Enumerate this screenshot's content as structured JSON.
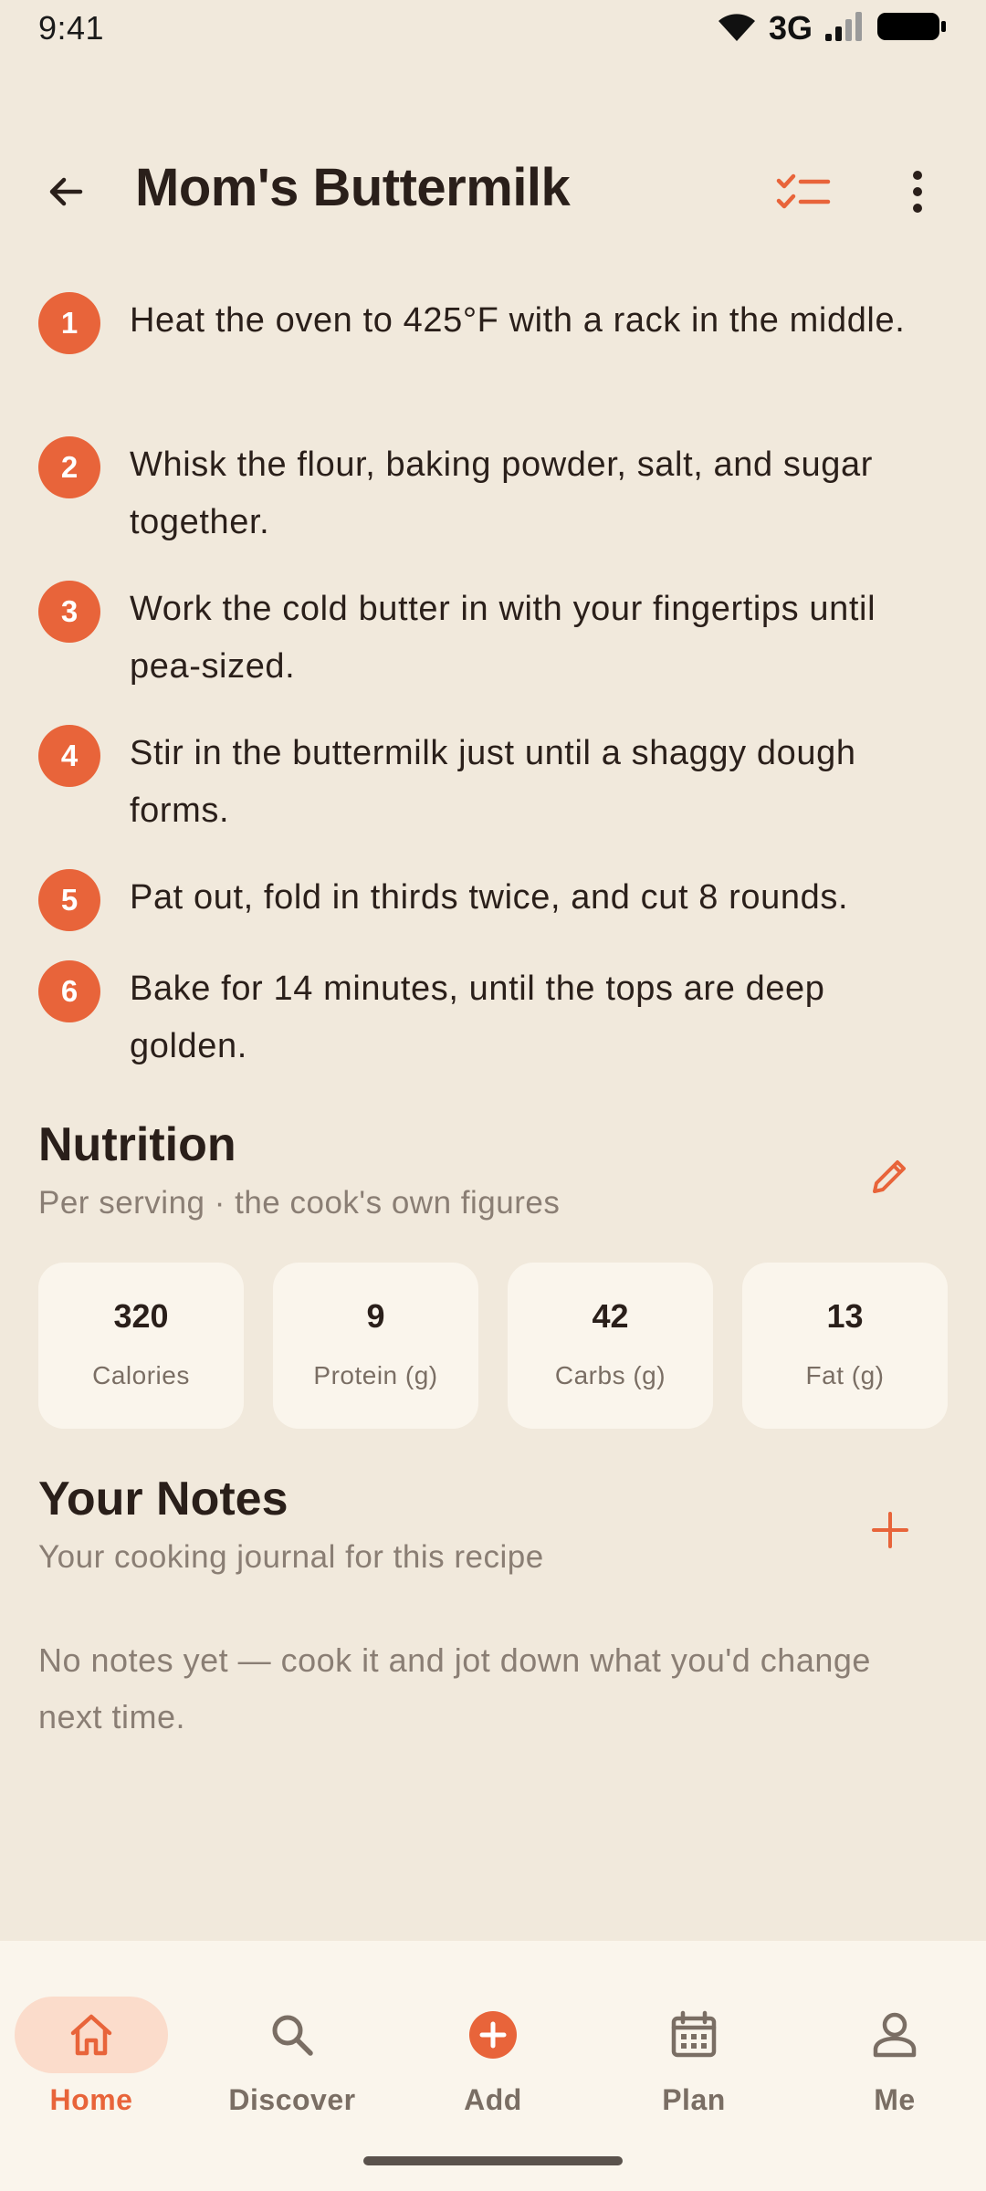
{
  "status_bar": {
    "time": "9:41",
    "network": "3G",
    "icons": [
      "wifi-icon",
      "signal-icon",
      "battery-icon"
    ]
  },
  "header": {
    "title": "Mom's Buttermilk",
    "icons": [
      "back-arrow-icon",
      "checklist-icon",
      "more-vertical-icon"
    ],
    "accent_color": "#E8643A"
  },
  "steps": [
    {
      "number": "1",
      "text": "Heat the oven to 425°F with a rack in the middle."
    },
    {
      "number": "2",
      "text": "Whisk the flour, baking powder, salt, and sugar together."
    },
    {
      "number": "3",
      "text": "Work the cold butter in with your fingertips until pea-sized."
    },
    {
      "number": "4",
      "text": "Stir in the buttermilk just until a shaggy dough forms."
    },
    {
      "number": "5",
      "text": "Pat out, fold in thirds twice, and cut 8 rounds."
    },
    {
      "number": "6",
      "text": "Bake for 14 minutes, until the tops are deep golden."
    }
  ],
  "nutrition": {
    "title": "Nutrition",
    "subtitle": "Per serving · the cook's own figures",
    "items": [
      {
        "value": "320",
        "label": "Calories"
      },
      {
        "value": "9",
        "label": "Protein (g)"
      },
      {
        "value": "42",
        "label": "Carbs (g)"
      },
      {
        "value": "13",
        "label": "Fat (g)"
      }
    ]
  },
  "notes": {
    "title": "Your Notes",
    "subtitle": "Your cooking journal for this recipe",
    "empty_text": "No notes yet — cook it and jot down what you'd change next time."
  },
  "bottom_nav": {
    "items": [
      {
        "label": "Home",
        "icon": "home-icon",
        "active": true
      },
      {
        "label": "Discover",
        "icon": "search-icon",
        "active": false
      },
      {
        "label": "Add",
        "icon": "add-circle-icon",
        "active": false
      },
      {
        "label": "Plan",
        "icon": "calendar-icon",
        "active": false
      },
      {
        "label": "Me",
        "icon": "person-icon",
        "active": false
      }
    ]
  },
  "colors": {
    "background": "#F1E9DC",
    "card": "#FAF5EC",
    "accent": "#E8643A",
    "text": "#2A1F1A",
    "muted": "#8A7E74"
  }
}
